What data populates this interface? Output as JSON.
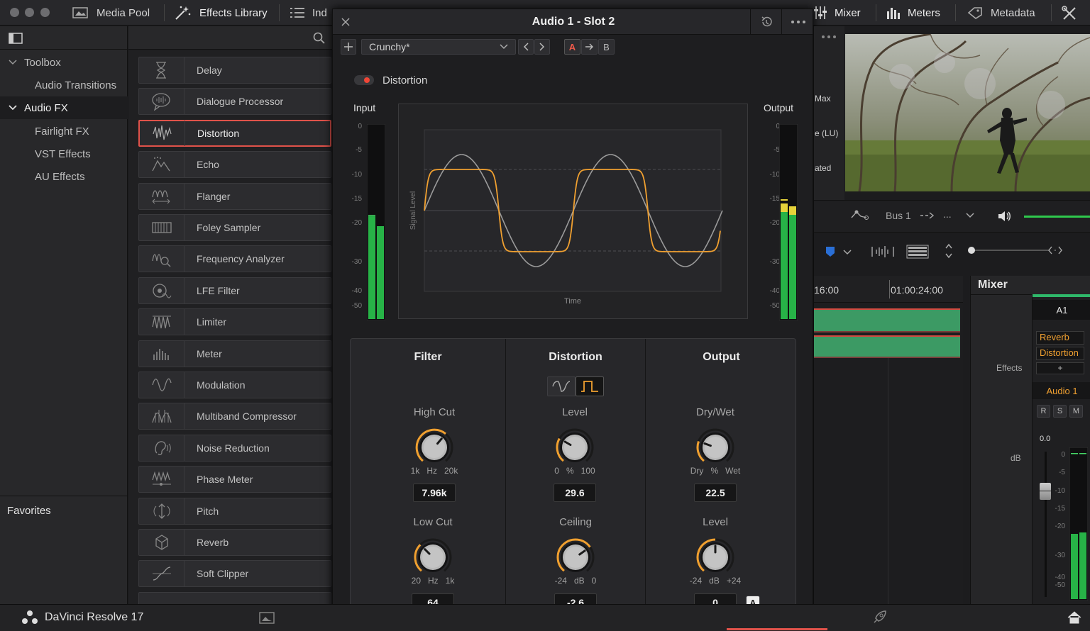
{
  "topbar": {
    "media_pool": "Media Pool",
    "effects_library": "Effects Library",
    "index": "Ind",
    "mixer": "Mixer",
    "meters": "Meters",
    "metadata": "Metadata"
  },
  "left": {
    "toolbox": "Toolbox",
    "audio_transitions": "Audio Transitions",
    "audio_fx": "Audio FX",
    "fairlight_fx": "Fairlight FX",
    "vst_effects": "VST Effects",
    "au_effects": "AU Effects",
    "favorites": "Favorites"
  },
  "fx_list": [
    {
      "label": "Delay",
      "icon": "hourglass-icon"
    },
    {
      "label": "Dialogue Processor",
      "icon": "speech-bubble-icon"
    },
    {
      "label": "Distortion",
      "icon": "distortion-wave-icon",
      "selected": true
    },
    {
      "label": "Echo",
      "icon": "mountains-icon"
    },
    {
      "label": "Flanger",
      "icon": "flanger-wave-icon"
    },
    {
      "label": "Foley Sampler",
      "icon": "keyboard-icon"
    },
    {
      "label": "Frequency Analyzer",
      "icon": "magnifier-wave-icon"
    },
    {
      "label": "LFE Filter",
      "icon": "speaker-wave-icon"
    },
    {
      "label": "Limiter",
      "icon": "limiter-wave-icon"
    },
    {
      "label": "Meter",
      "icon": "meter-bars-icon"
    },
    {
      "label": "Modulation",
      "icon": "sine-wave-icon"
    },
    {
      "label": "Multiband Compressor",
      "icon": "multiband-icon"
    },
    {
      "label": "Noise Reduction",
      "icon": "ear-icon"
    },
    {
      "label": "Phase Meter",
      "icon": "phase-wave-icon"
    },
    {
      "label": "Pitch",
      "icon": "pitch-arrows-icon"
    },
    {
      "label": "Reverb",
      "icon": "cube-icon"
    },
    {
      "label": "Soft Clipper",
      "icon": "soft-clip-curve-icon"
    }
  ],
  "plugin": {
    "title": "Audio 1 - Slot 2",
    "preset": "Crunchy*",
    "ab_a": "A",
    "ab_b": "B",
    "enable_label": "Distortion",
    "input_label": "Input",
    "output_label": "Output",
    "meter_ticks": [
      "0",
      "-5",
      "-10",
      "-15",
      "-20",
      "-30",
      "-40",
      "-50"
    ],
    "graph_ylabel": "Signal Level",
    "graph_xlabel": "Time",
    "sections": {
      "filter": "Filter",
      "distortion": "Distortion",
      "output": "Output"
    },
    "knobs": {
      "high_cut": {
        "label": "High Cut",
        "min": "1k",
        "unit": "Hz",
        "max": "20k",
        "value": "7.96k"
      },
      "low_cut": {
        "label": "Low Cut",
        "min": "20",
        "unit": "Hz",
        "max": "1k",
        "value": "64"
      },
      "level": {
        "label": "Level",
        "min": "0",
        "unit": "%",
        "max": "100",
        "value": "29.6"
      },
      "ceiling": {
        "label": "Ceiling",
        "min": "-24",
        "unit": "dB",
        "max": "0",
        "value": "-2.6"
      },
      "dry_wet": {
        "label": "Dry/Wet",
        "min": "Dry",
        "unit": "%",
        "max": "Wet",
        "value": "22.5"
      },
      "out_level": {
        "label": "Level",
        "min": "-24",
        "unit": "dB",
        "max": "+24",
        "value": "0"
      }
    },
    "auto_label": "A"
  },
  "right": {
    "max": "Max",
    "lu": "e (LU)",
    "ated": "ated",
    "bus": "Bus 1",
    "ellipsis": "...",
    "tc1": "16:00",
    "tc2": "01:00:24:00",
    "mixer_title": "Mixer",
    "channel": "A1",
    "effects_label": "Effects",
    "slot_reverb": "Reverb",
    "slot_distortion": "Distortion",
    "add_slot": "+",
    "track_name": "Audio 1",
    "r": "R",
    "s": "S",
    "m": "M",
    "db": "dB",
    "fader_value": "0.0",
    "fader_ticks": [
      "0",
      "-5",
      "-10",
      "-15",
      "-20",
      "-30",
      "-40",
      "-50"
    ]
  },
  "bottom": {
    "app": "DaVinci Resolve 17"
  },
  "colors": {
    "accent_orange": "#f0a030",
    "meter_green": "#29b84a",
    "selected_red": "#e0524a"
  }
}
